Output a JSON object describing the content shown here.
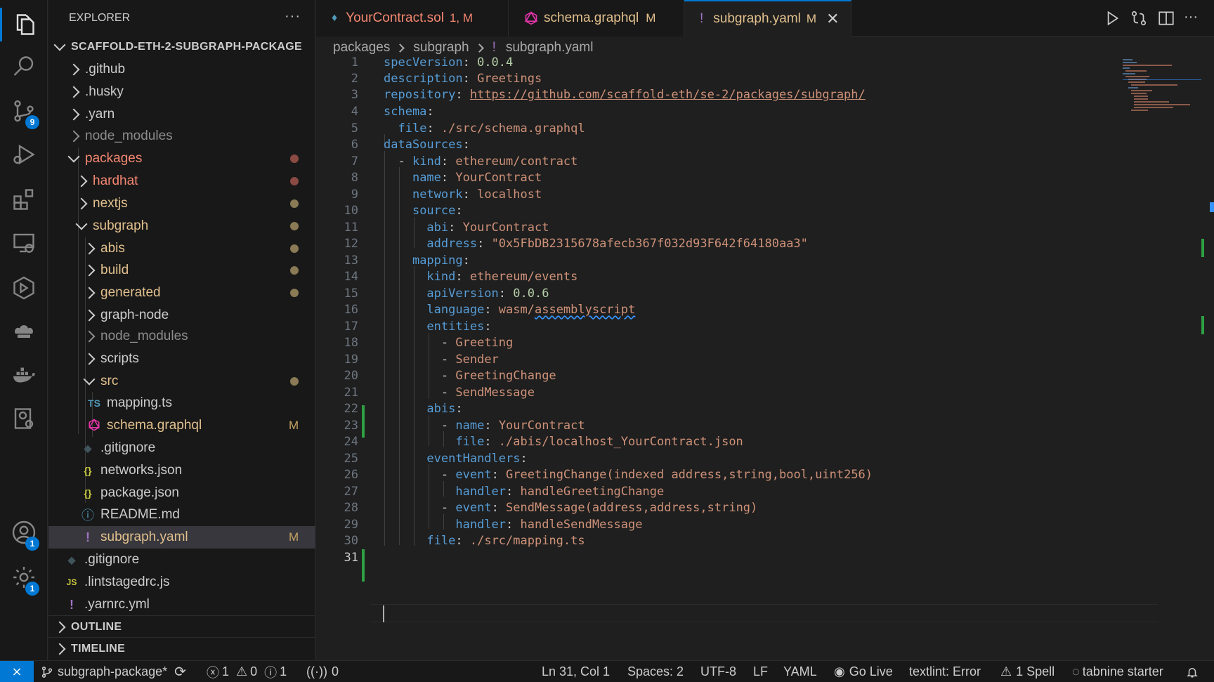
{
  "activity": {
    "source_control_badge": "9",
    "accounts_badge": "1",
    "settings_badge": "1"
  },
  "explorer": {
    "title": "EXPLORER",
    "more": "···",
    "root": "SCAFFOLD-ETH-2-SUBGRAPH-PACKAGE",
    "items": [
      {
        "label": ".github"
      },
      {
        "label": ".husky"
      },
      {
        "label": ".yarn"
      },
      {
        "label": "node_modules"
      },
      {
        "label": "packages"
      },
      {
        "label": "hardhat"
      },
      {
        "label": "nextjs"
      },
      {
        "label": "subgraph"
      },
      {
        "label": "abis"
      },
      {
        "label": "build"
      },
      {
        "label": "generated"
      },
      {
        "label": "graph-node"
      },
      {
        "label": "node_modules"
      },
      {
        "label": "scripts"
      },
      {
        "label": "src"
      },
      {
        "label": "mapping.ts",
        "icon": "TS"
      },
      {
        "label": "schema.graphql",
        "flag": "M"
      },
      {
        "label": ".gitignore"
      },
      {
        "label": "networks.json",
        "icon": "{}"
      },
      {
        "label": "package.json",
        "icon": "{}"
      },
      {
        "label": "README.md",
        "icon": "ⓘ"
      },
      {
        "label": "subgraph.yaml",
        "icon": "!",
        "flag": "M"
      },
      {
        "label": ".gitignore"
      },
      {
        "label": ".lintstagedrc.js",
        "icon": "JS"
      },
      {
        "label": ".yarnrc.yml",
        "icon": "!"
      }
    ],
    "outline": "OUTLINE",
    "timeline": "TIMELINE"
  },
  "tabs": [
    {
      "label": "YourContract.sol",
      "badge": "1, M"
    },
    {
      "label": "schema.graphql",
      "badge": "M"
    },
    {
      "label": "subgraph.yaml",
      "badge": "M"
    }
  ],
  "breadcrumb": [
    "packages",
    "subgraph",
    "subgraph.yaml"
  ],
  "editor": {
    "line_numbers": [
      "1",
      "2",
      "3",
      "4",
      "5",
      "6",
      "7",
      "8",
      "9",
      "10",
      "11",
      "12",
      "13",
      "14",
      "15",
      "16",
      "17",
      "18",
      "19",
      "20",
      "21",
      "22",
      "23",
      "24",
      "25",
      "26",
      "27",
      "28",
      "29",
      "30",
      "31"
    ],
    "code": {
      "l1k": "specVersion",
      "l1v": "0.0.4",
      "l2k": "description",
      "l2v": "Greetings",
      "l3k": "repository",
      "l3v": "https://github.com/scaffold-eth/se-2/packages/subgraph/",
      "l4k": "schema",
      "l5k": "file",
      "l5v": "./src/schema.graphql",
      "l6k": "dataSources",
      "l7k": "kind",
      "l7v": "ethereum/contract",
      "l8k": "name",
      "l8v": "YourContract",
      "l9k": "network",
      "l9v": "localhost",
      "l10k": "source",
      "l11k": "abi",
      "l11v": "YourContract",
      "l12k": "address",
      "l12v": "\"0x5FbDB2315678afecb367f032d93F642f64180aa3\"",
      "l13k": "mapping",
      "l14k": "kind",
      "l14v": "ethereum/events",
      "l15k": "apiVersion",
      "l15v": "0.0.6",
      "l16k": "language",
      "l16v1": "wasm/",
      "l16v2": "assemblyscript",
      "l17k": "entities",
      "l18v": "Greeting",
      "l19v": "Sender",
      "l20v": "GreetingChange",
      "l21v": "SendMessage",
      "l22k": "abis",
      "l23k": "name",
      "l23v": "YourContract",
      "l24k": "file",
      "l24v": "./abis/localhost_YourContract.json",
      "l25k": "eventHandlers",
      "l26k": "event",
      "l26v": "GreetingChange(indexed address,string,bool,uint256)",
      "l27k": "handler",
      "l27v": "handleGreetingChange",
      "l28k": "event",
      "l28v": "SendMessage(address,address,string)",
      "l29k": "handler",
      "l29v": "handleSendMessage",
      "l30k": "file",
      "l30v": "./src/mapping.ts"
    }
  },
  "status": {
    "branch": "subgraph-package*",
    "errors": "1",
    "warnings": "0",
    "infos": "1",
    "ports": "0",
    "position": "Ln 31, Col 1",
    "spaces": "Spaces: 2",
    "encoding": "UTF-8",
    "eol": "LF",
    "language": "YAML",
    "golive": "Go Live",
    "textlint": "textlint: Error",
    "spell": "1 Spell",
    "tabnine": "tabnine starter"
  },
  "colors": {
    "accent": "#0078d4",
    "modified_red": "#f48771",
    "modified_yellow": "#e2c08d",
    "git_added": "#2ea043"
  }
}
